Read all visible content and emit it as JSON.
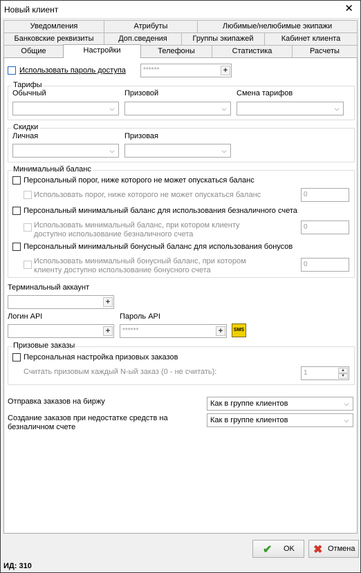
{
  "window": {
    "title": "Новый клиент",
    "close": "✕"
  },
  "tabs": {
    "row1": [
      "Уведомления",
      "Атрибуты",
      "Любимые/нелюбимые экипажи"
    ],
    "row2": [
      "Банковские реквизиты",
      "Доп.сведения",
      "Группы экипажей",
      "Кабинет клиента"
    ],
    "row3": [
      "Общие",
      "Настройки",
      "Телефоны",
      "Статистика",
      "Расчеты"
    ],
    "active": "Настройки"
  },
  "password": {
    "label": "Использовать пароль доступа",
    "value": "******"
  },
  "tariffs": {
    "title": "Тарифы",
    "regular": "Обычный",
    "prize": "Призовой",
    "change": "Смена тарифов"
  },
  "discounts": {
    "title": "Скидки",
    "personal": "Личная",
    "prize": "Призовая"
  },
  "min_balance": {
    "title": "Минимальный баланс",
    "o1": "Персональный порог, ниже которого не может опускаться баланс",
    "o1_sub": "Использовать порог, ниже которого не может опускаться баланс",
    "o1_val": "0",
    "o2": "Персональный минимальный баланс для использования безналичного счета",
    "o2_sub1": "Использовать минимальный баланс, при котором клиенту",
    "o2_sub2": "доступно использование безналичного счета",
    "o2_val": "0",
    "o3": "Персональный минимальный бонусный баланс для использования бонусов",
    "o3_sub1": "Использовать минимальный бонусный баланс, при котором",
    "o3_sub2": "клиенту доступно использование бонусного счета",
    "o3_val": "0"
  },
  "terminal": {
    "label": "Терминальный аккаунт"
  },
  "api": {
    "login_label": "Логин API",
    "password_label": "Пароль API",
    "password_value": "******",
    "sms": "SMS"
  },
  "prize_orders": {
    "title": "Призовые заказы",
    "personal": "Персональная настройка призовых заказов",
    "nth": "Считать призовым каждый N-ый заказ (0 - не считать):",
    "nth_val": "1"
  },
  "exchange": {
    "label": "Отправка заказов на биржу",
    "value": "Как в группе клиентов"
  },
  "insufficient": {
    "label1": "Создание заказов при недостатке средств на",
    "label2": "безналичном счете",
    "value": "Как в группе клиентов"
  },
  "buttons": {
    "ok": "OK",
    "cancel": "Отмена"
  },
  "status": {
    "id": "ИД: 310"
  },
  "colors": {
    "ok_check": "#3a9a2a",
    "cancel_x": "#d2382c",
    "sms_bg": "#f0d000"
  }
}
